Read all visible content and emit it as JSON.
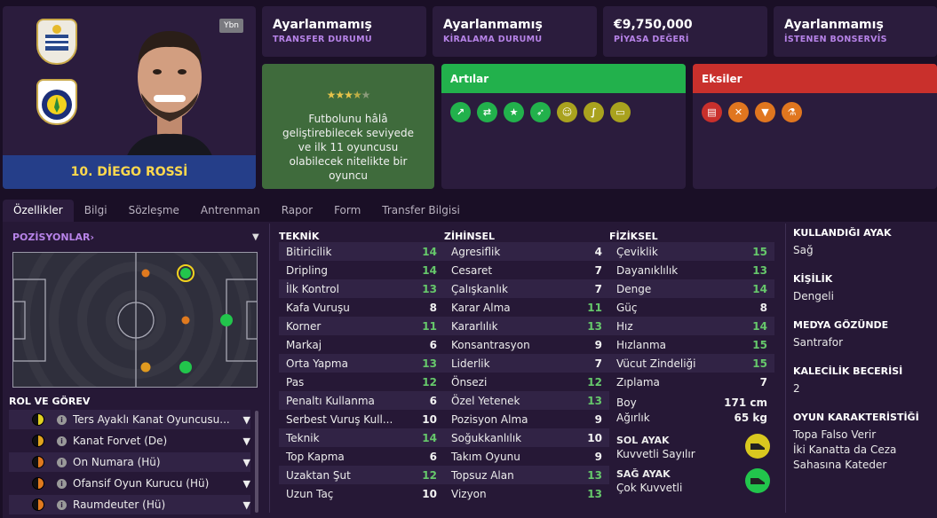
{
  "player": {
    "name": "10. DİEGO ROSSİ",
    "badge": "Ybn"
  },
  "info": [
    {
      "value": "Ayarlanmamış",
      "label": "TRANSFER DURUMU"
    },
    {
      "value": "Ayarlanmamış",
      "label": "KİRALAMA DURUMU"
    },
    {
      "value": "€9,750,000",
      "label": "PİYASA DEĞERİ"
    },
    {
      "value": "Ayarlanmamış",
      "label": "İSTENEN BONSERVİS"
    }
  ],
  "report": {
    "stars": "★★★★★",
    "rating": 3.5,
    "text": "Futbolunu hâlâ geliştirebilecek seviyede ve ilk 11 oyuncusu olabilecek nitelikte bir oyuncu"
  },
  "pros": {
    "title": "Artılar",
    "icons": [
      "trend-up-icon",
      "handshake-icon",
      "star-icon",
      "boot-icon",
      "head-icon",
      "dribble-icon",
      "pitch-icon"
    ]
  },
  "cons": {
    "title": "Eksiler",
    "icons": [
      "card-icon",
      "tackle-icon",
      "shield-icon",
      "flask-icon"
    ]
  },
  "tabs": [
    "Özellikler",
    "Bilgi",
    "Sözleşme",
    "Antrenman",
    "Rapor",
    "Form",
    "Transfer Bilgisi"
  ],
  "positions": {
    "title": "POZİSYONLAR",
    "chevron": "›"
  },
  "roles": {
    "title": "ROL VE GÖREV",
    "items": [
      {
        "name": "Ters Ayaklı Kanat Oyuncusu...",
        "color": "#e0d022"
      },
      {
        "name": "Kanat Forvet (De)",
        "color": "#e0a41f"
      },
      {
        "name": "On Numara (Hü)",
        "color": "#e07a1f"
      },
      {
        "name": "Ofansif Oyun Kurucu (Hü)",
        "color": "#e07a1f"
      },
      {
        "name": "Raumdeuter (Hü)",
        "color": "#e07a1f"
      }
    ]
  },
  "technical": {
    "title": "TEKNİK",
    "rows": [
      [
        "Bitiricilik",
        "14"
      ],
      [
        "Dripling",
        "14"
      ],
      [
        "İlk Kontrol",
        "13"
      ],
      [
        "Kafa Vuruşu",
        "8"
      ],
      [
        "Korner",
        "11"
      ],
      [
        "Markaj",
        "6"
      ],
      [
        "Orta Yapma",
        "13"
      ],
      [
        "Pas",
        "12"
      ],
      [
        "Penaltı Kullanma",
        "6"
      ],
      [
        "Serbest Vuruş Kull...",
        "10"
      ],
      [
        "Teknik",
        "14"
      ],
      [
        "Top Kapma",
        "6"
      ],
      [
        "Uzaktan Şut",
        "12"
      ],
      [
        "Uzun Taç",
        "10"
      ]
    ]
  },
  "mental": {
    "title": "ZİHİNSEL",
    "rows": [
      [
        "Agresiflik",
        "4"
      ],
      [
        "Cesaret",
        "7"
      ],
      [
        "Çalışkanlık",
        "7"
      ],
      [
        "Karar Alma",
        "11"
      ],
      [
        "Kararlılık",
        "13"
      ],
      [
        "Konsantrasyon",
        "9"
      ],
      [
        "Liderlik",
        "7"
      ],
      [
        "Önsezi",
        "12"
      ],
      [
        "Özel Yetenek",
        "13"
      ],
      [
        "Pozisyon Alma",
        "9"
      ],
      [
        "Soğukkanlılık",
        "10"
      ],
      [
        "Takım Oyunu",
        "9"
      ],
      [
        "Topsuz Alan",
        "13"
      ],
      [
        "Vizyon",
        "13"
      ]
    ]
  },
  "physical": {
    "title": "FİZİKSEL",
    "rows": [
      [
        "Çeviklik",
        "15"
      ],
      [
        "Dayanıklılık",
        "13"
      ],
      [
        "Denge",
        "14"
      ],
      [
        "Güç",
        "8"
      ],
      [
        "Hız",
        "14"
      ],
      [
        "Hızlanma",
        "15"
      ],
      [
        "Vücut Zindeliği",
        "15"
      ],
      [
        "Zıplama",
        "7"
      ]
    ],
    "height_label": "Boy",
    "height": "171 cm",
    "weight_label": "Ağırlık",
    "weight": "65 kg",
    "left_foot_label": "SOL AYAK",
    "left_foot": "Kuvvetli Sayılır",
    "right_foot_label": "SAĞ AYAK",
    "right_foot": "Çok Kuvvetli"
  },
  "side": [
    {
      "h": "KULLANDIĞI AYAK",
      "v": [
        "Sağ"
      ]
    },
    {
      "h": "KİŞİLİK",
      "v": [
        "Dengeli"
      ]
    },
    {
      "h": "MEDYA GÖZÜNDE",
      "v": [
        "Santrafor"
      ]
    },
    {
      "h": "KALECİLİK BECERİSİ",
      "v": [
        "2"
      ]
    },
    {
      "h": "OYUN KARAKTERİSTİĞİ",
      "v": [
        "Topa Falso Verir",
        "İki Kanatta da Ceza",
        "Sahasına Kateder"
      ]
    }
  ],
  "colors": {
    "green": "#66c86b",
    "accent": "#b783e8",
    "pros": "#22b14c",
    "cons": "#c9302c"
  }
}
